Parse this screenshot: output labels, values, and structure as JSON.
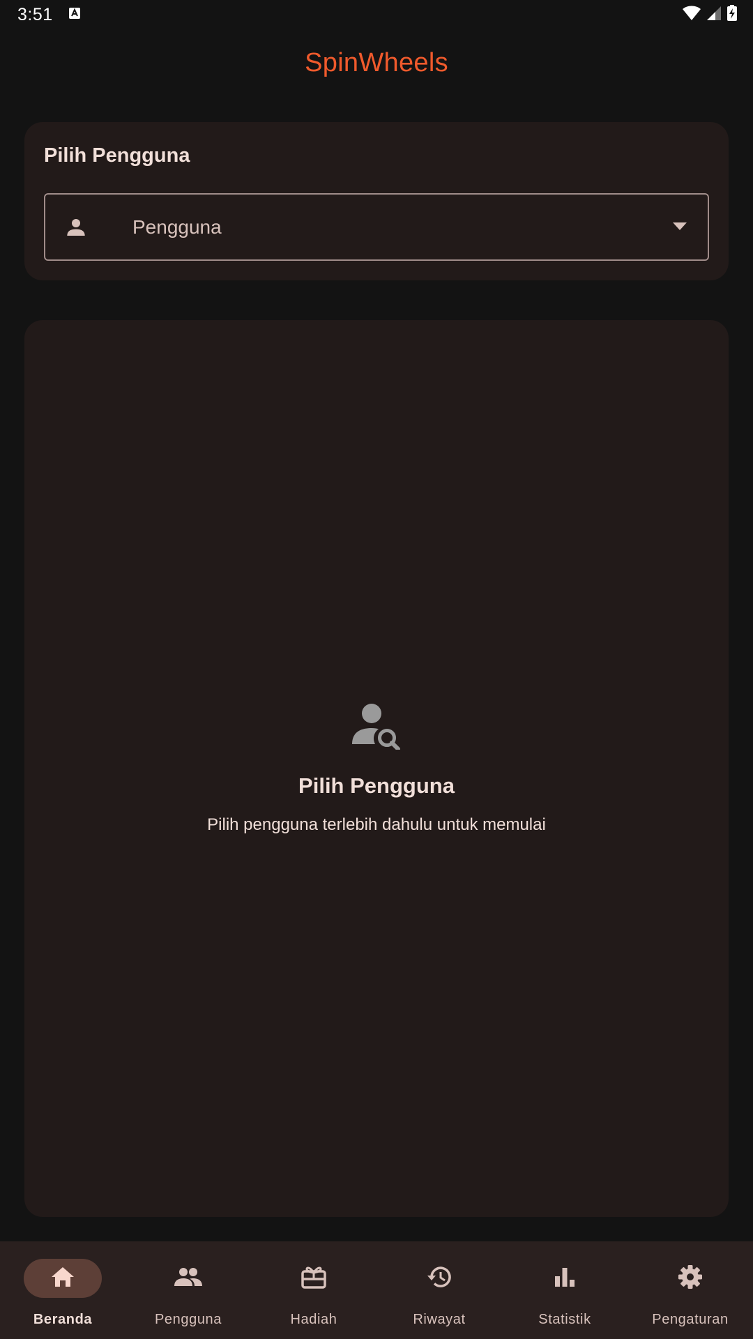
{
  "status_bar": {
    "time": "3:51"
  },
  "app_bar": {
    "title": "SpinWheels"
  },
  "user_select_card": {
    "title": "Pilih Pengguna",
    "dropdown_placeholder": "Pengguna"
  },
  "empty_state": {
    "icon": "person-search-icon",
    "title": "Pilih Pengguna",
    "subtitle": "Pilih pengguna terlebih dahulu untuk memulai"
  },
  "bottom_nav": {
    "items": [
      {
        "label": "Beranda",
        "icon": "home-icon",
        "active": true
      },
      {
        "label": "Pengguna",
        "icon": "people-icon",
        "active": false
      },
      {
        "label": "Hadiah",
        "icon": "gift-card-icon",
        "active": false
      },
      {
        "label": "Riwayat",
        "icon": "history-icon",
        "active": false
      },
      {
        "label": "Statistik",
        "icon": "bar-chart-icon",
        "active": false
      },
      {
        "label": "Pengaturan",
        "icon": "gear-icon",
        "active": false
      }
    ]
  },
  "colors": {
    "background": "#131313",
    "card": "#221a19",
    "accent_title": "#f05a2c",
    "nav_background": "#2a201f",
    "nav_active_pill": "#5d3f37"
  }
}
